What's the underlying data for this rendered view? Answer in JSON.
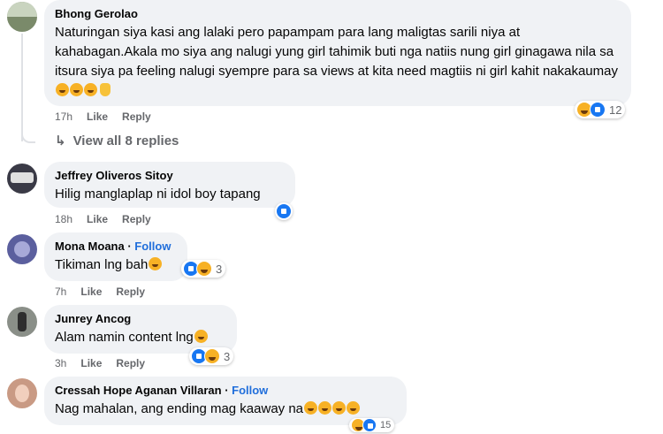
{
  "comments": [
    {
      "name": "Bhong Gerolao",
      "follow": "",
      "text": "Naturingan siya kasi ang lalaki pero papampam para lang maligtas sarili niya at kahabagan.Akala mo siya ang nalugi yung girl tahimik buti nga natiis nung girl ginagawa nila sa itsura siya pa feeling nalugi syempre para sa views at kita need magtiis ni girl kahit nakakaumay",
      "time": "17h",
      "like": "Like",
      "reply": "Reply",
      "reaction_count": "12",
      "avatar_color": "#7a8a6a"
    },
    {
      "name": "Jeffrey Oliveros Sitoy",
      "follow": "",
      "text": "Hilig manglaplap ni idol boy tapang",
      "time": "18h",
      "like": "Like",
      "reply": "Reply",
      "reaction_count": "",
      "avatar_color": "#3a3a46"
    },
    {
      "name": "Mona Moana",
      "follow": "Follow",
      "text": "Tikiman lng bah",
      "time": "7h",
      "like": "Like",
      "reply": "Reply",
      "reaction_count": "3",
      "avatar_color": "#5b5f9e"
    },
    {
      "name": "Junrey Ancog",
      "follow": "",
      "text": "Alam namin content lng",
      "time": "3h",
      "like": "Like",
      "reply": "Reply",
      "reaction_count": "3",
      "avatar_color": "#8a8f88"
    },
    {
      "name": "Cressah Hope Aganan Villaran",
      "follow": "Follow",
      "text": "Nag mahalan, ang ending mag kaaway na",
      "time": "",
      "like": "",
      "reply": "",
      "reaction_count": "15",
      "avatar_color": "#c99a84"
    }
  ],
  "view_replies": "View all 8 replies",
  "follow_separator": " · ",
  "colors": {
    "accent": "#216fdb",
    "bubble": "#f0f2f5",
    "meta": "#65676b"
  }
}
